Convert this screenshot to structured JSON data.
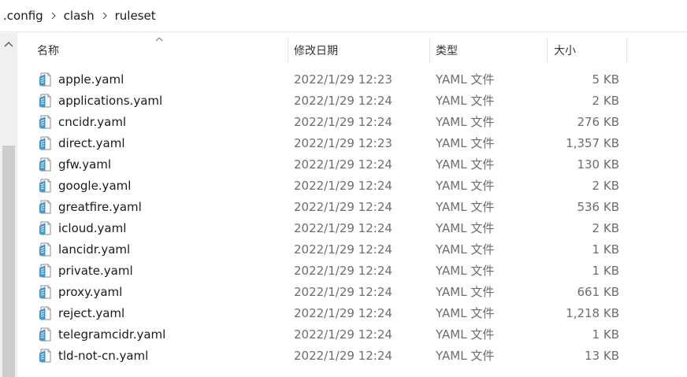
{
  "breadcrumb": [
    ".config",
    "clash",
    "ruleset"
  ],
  "columns": {
    "name": "名称",
    "date": "修改日期",
    "type": "类型",
    "size": "大小"
  },
  "files": [
    {
      "name": "apple.yaml",
      "date": "2022/1/29 12:23",
      "type": "YAML 文件",
      "size": "5 KB"
    },
    {
      "name": "applications.yaml",
      "date": "2022/1/29 12:24",
      "type": "YAML 文件",
      "size": "2 KB"
    },
    {
      "name": "cncidr.yaml",
      "date": "2022/1/29 12:24",
      "type": "YAML 文件",
      "size": "276 KB"
    },
    {
      "name": "direct.yaml",
      "date": "2022/1/29 12:23",
      "type": "YAML 文件",
      "size": "1,357 KB"
    },
    {
      "name": "gfw.yaml",
      "date": "2022/1/29 12:24",
      "type": "YAML 文件",
      "size": "130 KB"
    },
    {
      "name": "google.yaml",
      "date": "2022/1/29 12:24",
      "type": "YAML 文件",
      "size": "2 KB"
    },
    {
      "name": "greatfire.yaml",
      "date": "2022/1/29 12:24",
      "type": "YAML 文件",
      "size": "536 KB"
    },
    {
      "name": "icloud.yaml",
      "date": "2022/1/29 12:24",
      "type": "YAML 文件",
      "size": "2 KB"
    },
    {
      "name": "lancidr.yaml",
      "date": "2022/1/29 12:24",
      "type": "YAML 文件",
      "size": "1 KB"
    },
    {
      "name": "private.yaml",
      "date": "2022/1/29 12:24",
      "type": "YAML 文件",
      "size": "1 KB"
    },
    {
      "name": "proxy.yaml",
      "date": "2022/1/29 12:24",
      "type": "YAML 文件",
      "size": "661 KB"
    },
    {
      "name": "reject.yaml",
      "date": "2022/1/29 12:24",
      "type": "YAML 文件",
      "size": "1,218 KB"
    },
    {
      "name": "telegramcidr.yaml",
      "date": "2022/1/29 12:24",
      "type": "YAML 文件",
      "size": "1 KB"
    },
    {
      "name": "tld-not-cn.yaml",
      "date": "2022/1/29 12:24",
      "type": "YAML 文件",
      "size": "13 KB"
    }
  ]
}
